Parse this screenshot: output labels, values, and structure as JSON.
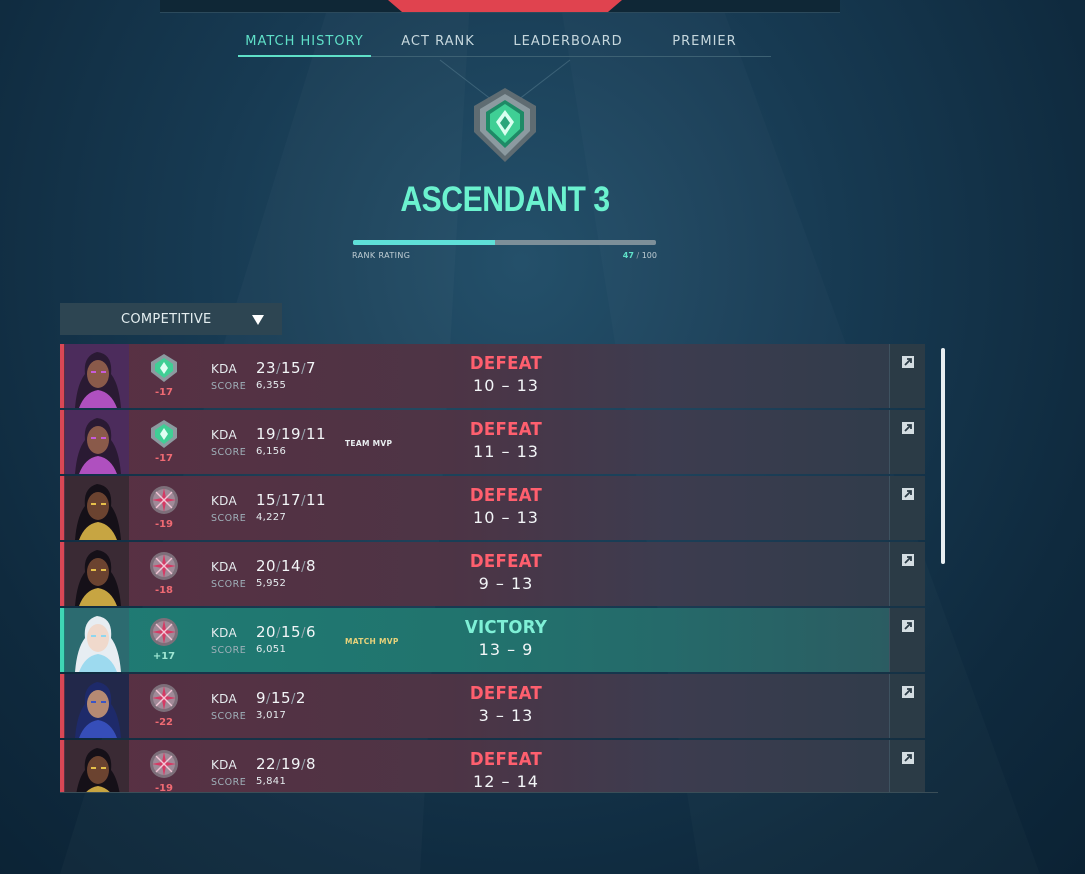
{
  "colors": {
    "accent_teal": "#5fe0c8",
    "defeat": "#ff5f6e",
    "victory": "#7ff0d6",
    "loss_row": "#4d3445",
    "win_row": "#21746e"
  },
  "tabs": [
    {
      "label": "MATCH HISTORY",
      "active": true
    },
    {
      "label": "ACT RANK",
      "active": false
    },
    {
      "label": "LEADERBOARD",
      "active": false
    },
    {
      "label": "PREMIER",
      "active": false
    }
  ],
  "rank": {
    "name": "ASCENDANT 3",
    "emblem_icon": "ascendant-rank-icon",
    "rr_label": "RANK RATING",
    "rr_current": "47",
    "rr_max": "100",
    "rr_fraction": 0.47
  },
  "queue": {
    "selected": "COMPETITIVE",
    "icon": "caret-down-icon"
  },
  "matches": [
    {
      "agent": "Reyna",
      "rank_icon": "ascendant-rank-icon",
      "rr_change": "-17",
      "kda_label": "KDA",
      "kills": "23",
      "deaths": "15",
      "assists": "7",
      "score_label": "SCORE",
      "score": "6,355",
      "mvp": "",
      "result": "DEFEAT",
      "team_score": "10",
      "enemy_score": "13",
      "outcome": "loss"
    },
    {
      "agent": "Reyna",
      "rank_icon": "ascendant-rank-icon",
      "rr_change": "-17",
      "kda_label": "KDA",
      "kills": "19",
      "deaths": "19",
      "assists": "11",
      "score_label": "SCORE",
      "score": "6,156",
      "mvp": "TEAM MVP",
      "result": "DEFEAT",
      "team_score": "11",
      "enemy_score": "13",
      "outcome": "loss"
    },
    {
      "agent": "Neon",
      "rank_icon": "immortal-rank-icon",
      "rr_change": "-19",
      "kda_label": "KDA",
      "kills": "15",
      "deaths": "17",
      "assists": "11",
      "score_label": "SCORE",
      "score": "4,227",
      "mvp": "",
      "result": "DEFEAT",
      "team_score": "10",
      "enemy_score": "13",
      "outcome": "loss"
    },
    {
      "agent": "Neon",
      "rank_icon": "immortal-rank-icon",
      "rr_change": "-18",
      "kda_label": "KDA",
      "kills": "20",
      "deaths": "14",
      "assists": "8",
      "score_label": "SCORE",
      "score": "5,952",
      "mvp": "",
      "result": "DEFEAT",
      "team_score": "9",
      "enemy_score": "13",
      "outcome": "loss"
    },
    {
      "agent": "Jett",
      "rank_icon": "immortal-rank-icon",
      "rr_change": "+17",
      "kda_label": "KDA",
      "kills": "20",
      "deaths": "15",
      "assists": "6",
      "score_label": "SCORE",
      "score": "6,051",
      "mvp": "MATCH MVP",
      "result": "VICTORY",
      "team_score": "13",
      "enemy_score": "9",
      "outcome": "win"
    },
    {
      "agent": "Yoru",
      "rank_icon": "immortal-rank-icon",
      "rr_change": "-22",
      "kda_label": "KDA",
      "kills": "9",
      "deaths": "15",
      "assists": "2",
      "score_label": "SCORE",
      "score": "3,017",
      "mvp": "",
      "result": "DEFEAT",
      "team_score": "3",
      "enemy_score": "13",
      "outcome": "loss"
    },
    {
      "agent": "Neon",
      "rank_icon": "immortal-rank-icon",
      "rr_change": "-19",
      "kda_label": "KDA",
      "kills": "22",
      "deaths": "19",
      "assists": "8",
      "score_label": "SCORE",
      "score": "5,841",
      "mvp": "",
      "result": "DEFEAT",
      "team_score": "12",
      "enemy_score": "14",
      "outcome": "loss"
    }
  ]
}
